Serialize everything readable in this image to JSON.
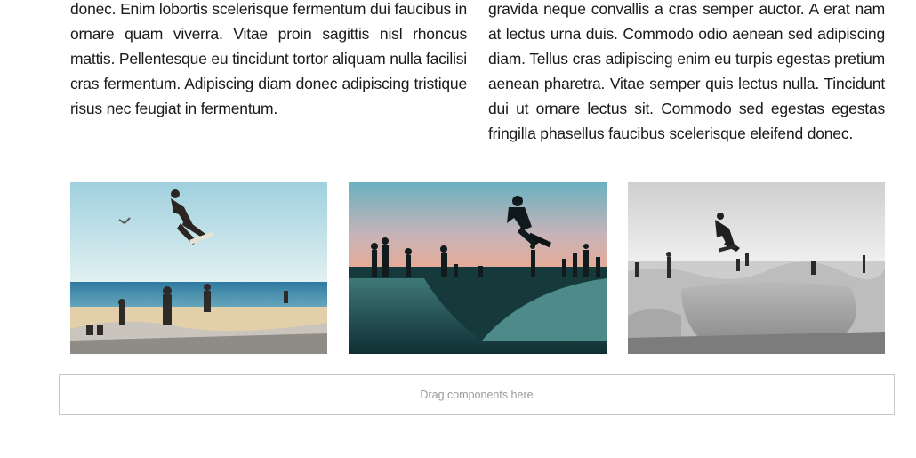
{
  "article": {
    "left_paragraph": "donec. Enim lobortis scelerisque fermentum dui faucibus in ornare quam viverra. Vitae proin sagittis nisl rhoncus mattis. Pellentesque eu tincidunt tortor aliquam nulla facilisi cras fermentum. Adipiscing diam donec adipiscing tristique risus nec feugiat in fermentum.",
    "right_paragraph": "gravida neque convallis a cras semper auctor. A erat nam at lectus urna duis. Commodo odio aenean sed adipiscing diam. Tellus cras adipiscing enim eu turpis egestas pretium aenean pharetra. Vitae semper quis lectus nulla. Tincidunt dui ut ornare lectus sit. Commodo sed egestas egestas fringilla phasellus faucibus scelerisque eleifend donec."
  },
  "gallery": {
    "images": [
      {
        "subject": "skateboarder-beach-photo"
      },
      {
        "subject": "skateboarder-sunset-bowl-photo"
      },
      {
        "subject": "skateboarder-bw-skatepark-photo"
      }
    ]
  },
  "drop_zone": {
    "label": "Drag components here"
  }
}
